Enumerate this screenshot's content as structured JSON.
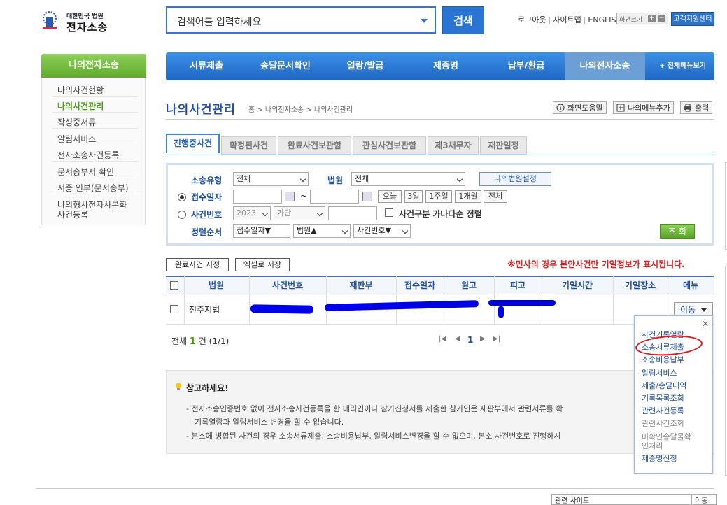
{
  "header": {
    "logo_top": "대한민국 법원",
    "logo_main": "전자소송",
    "search_placeholder": "검색어를 입력하세요",
    "search_button": "검색",
    "util_links": [
      "로그아웃",
      "사이트맵",
      "ENGLISH"
    ],
    "font_size_label": "화면크기",
    "font_plus": "+",
    "font_minus": "−",
    "customer_center": "고객지원센터"
  },
  "sidebar": {
    "title": "나의전자소송",
    "items": [
      {
        "label": "나의사건현황"
      },
      {
        "label": "나의사건관리",
        "active": true
      },
      {
        "label": "작성중서류"
      },
      {
        "label": "알림서비스"
      },
      {
        "label": "전자소송사건등록"
      },
      {
        "label": "문서송부서 확인"
      },
      {
        "label": "서증 인부(문서송부)"
      },
      {
        "label": "나의형사전자사본화"
      },
      {
        "label": "사건등록"
      }
    ]
  },
  "nav": {
    "items": [
      "서류제출",
      "송달문서확인",
      "열람/발급",
      "제증명",
      "납부/환급",
      "나의전자소송"
    ],
    "active": "나의전자소송",
    "all_menu": "+ 전체메뉴보기"
  },
  "page": {
    "title": "나의사건관리",
    "breadcrumb": "홈 > 나의전자소송 > 나의사건관리",
    "help_button": "화면도움말",
    "add_menu_button": "나의메뉴추가",
    "print_button": "출력"
  },
  "tabs": [
    "진행중사건",
    "확정된사건",
    "완료사건보관함",
    "관심사건보관함",
    "제3채무자",
    "재판일정"
  ],
  "filter": {
    "case_type_label": "소송유형",
    "case_type_value": "전체",
    "court_label": "법원",
    "court_value": "전체",
    "my_court_button": "나의법원설정",
    "receipt_date_label": "접수일자",
    "tilde": "~",
    "quick_dates": [
      "오늘",
      "3일",
      "1주일",
      "1개월",
      "전체"
    ],
    "case_no_label": "사건번호",
    "year_value": "2023",
    "gubun_value": "가단",
    "sort_checkbox_label": "사건구분 가나다순 정렬",
    "order_label": "정렬순서",
    "order_1": "접수일자▼",
    "order_2": "법원▲",
    "order_3": "사건번호▼",
    "query_button": "조 회"
  },
  "actions": {
    "complete_button": "완료사건 지정",
    "excel_button": "엑셀로 저장",
    "notice": "※민사의 경우 본안사건만 기일정보가 표시됩니다."
  },
  "table": {
    "headers": [
      "법원",
      "사건번호",
      "재판부",
      "접수일자",
      "원고",
      "피고",
      "기일시간",
      "기일장소",
      "메뉴"
    ],
    "rows": [
      {
        "court": "전주지법",
        "menu": "이동"
      }
    ]
  },
  "pagination": {
    "total_prefix": "전체",
    "total_count": "1",
    "total_suffix": "건 (1/1)",
    "first": "|◀",
    "prev": "◀",
    "current": "1",
    "next": "▶",
    "last": "▶|"
  },
  "popup": {
    "close": "✕",
    "items": [
      {
        "label": "사건기록열람",
        "enabled": true
      },
      {
        "label": "소송서류제출",
        "enabled": true
      },
      {
        "label": "소송비용납부",
        "enabled": true
      },
      {
        "label": "알림서비스",
        "enabled": true
      },
      {
        "label": "제출/송달내역",
        "enabled": true
      },
      {
        "label": "기록목록조회",
        "enabled": true
      },
      {
        "label": "관련사건등록",
        "enabled": true
      },
      {
        "label": "관련사건조회",
        "enabled": false
      },
      {
        "label": "미확인송달물확",
        "enabled": false
      },
      {
        "label": "인처리",
        "enabled": false
      },
      {
        "label": "제증명신청",
        "enabled": true
      }
    ]
  },
  "note": {
    "title": "참고하세요!",
    "lines": [
      "- 전자소송인증번호 없이 전자소송사건등록을 한 대리인이나 참가신청서를 제출한 참가인은 재판부에서 관련서류를 확",
      "기록열람과 알림서비스 변경을 할 수 없습니다.",
      "- 본소에 병합된 사건의 경우 소송서류제출, 소송비용납부, 알림서비스변경을 할 수 없으며, 본소 사건번호로 진행하시"
    ]
  },
  "footer": {
    "related_sites": "관련 사이트",
    "move": "이동"
  },
  "colors": {
    "primary_blue": "#1f66c2",
    "green": "#5faa2b",
    "notice_red": "#e41c1c",
    "redaction": "#0000e8",
    "annotation_circle": "#e01818"
  }
}
